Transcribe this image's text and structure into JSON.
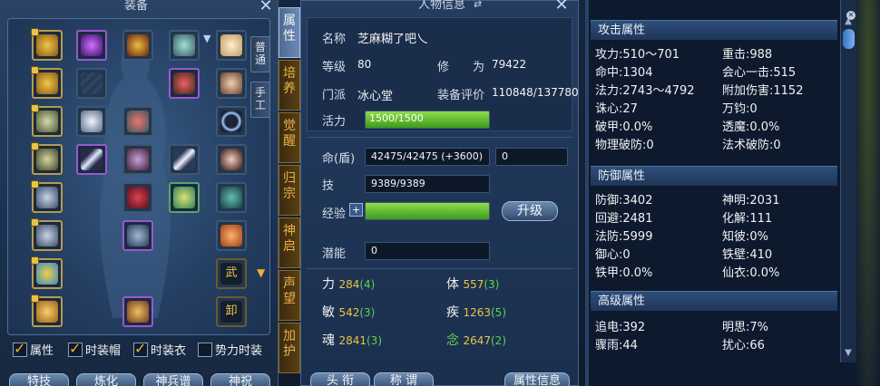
{
  "equip": {
    "title": "装备",
    "vtabs": [
      "普通",
      "手工"
    ],
    "slot_marks": {
      "wu": "武",
      "xie": "卸"
    },
    "checkboxes": [
      {
        "label": "属性",
        "checked": true
      },
      {
        "label": "时装帽",
        "checked": true
      },
      {
        "label": "时装衣",
        "checked": true
      },
      {
        "label": "势力时装",
        "checked": false
      }
    ],
    "buttons": [
      "特技",
      "炼化",
      "神兵谱",
      "神祝"
    ]
  },
  "side_tabs": [
    "属性",
    "培养",
    "觉醒",
    "归宗",
    "神启",
    "声望",
    "加护"
  ],
  "char": {
    "title": "人物信息",
    "name_label": "名称",
    "name": "芝麻糊了吧乀",
    "level_label": "等级",
    "level": "80",
    "cult_label": "修　　为",
    "cult": "79422",
    "school_label": "门派",
    "school": "冰心堂",
    "score_label": "装备评价",
    "score": "110848/137780",
    "vigor_label": "活力",
    "vigor": "1500/1500",
    "vigor_fill": 1.0,
    "hp_label": "命(盾)",
    "hp": "42475/42475 (+3600)",
    "shield": "0",
    "skill_label": "技",
    "skill": "9389/9389",
    "exp_label": "经验",
    "exp_plus": "+",
    "exp_fill": 1.0,
    "upgrade": "升级",
    "potential_label": "潜能",
    "potential": "0",
    "stats": [
      {
        "name": "力",
        "base": "284",
        "add": "(4)"
      },
      {
        "name": "体",
        "base": "557",
        "add": "(3)"
      },
      {
        "name": "敏",
        "base": "542",
        "add": "(3)"
      },
      {
        "name": "疾",
        "base": "1263",
        "add": "(5)"
      },
      {
        "name": "魂",
        "base": "2841",
        "add": "(3)"
      },
      {
        "name": "念",
        "base": "2647",
        "add": "(2)"
      }
    ],
    "buttons": [
      "头 衔",
      "称 谓",
      "属性信息"
    ]
  },
  "attrs": {
    "attack": {
      "title": "攻击属性",
      "items": [
        [
          "攻力:510～701",
          "重击:988"
        ],
        [
          "命中:1304",
          "会心一击:515"
        ],
        [
          "法力:2743～4792",
          "附加伤害:1152"
        ],
        [
          "诛心:27",
          "万钧:0"
        ],
        [
          "破甲:0.0%",
          "透魔:0.0%"
        ],
        [
          "物理破防:0",
          "法术破防:0"
        ]
      ]
    },
    "defense": {
      "title": "防御属性",
      "items": [
        [
          "防御:3402",
          "神明:2031"
        ],
        [
          "回避:2481",
          "化解:111"
        ],
        [
          "法防:5999",
          "知彼:0%"
        ],
        [
          "御心:0",
          "铁壁:410"
        ],
        [
          "铁甲:0.0%",
          "仙衣:0.0%"
        ]
      ]
    },
    "advanced": {
      "title": "高级属性",
      "items": [
        [
          "追电:392",
          "明思:7%"
        ],
        [
          "骤雨:44",
          "扰心:66"
        ]
      ]
    }
  }
}
